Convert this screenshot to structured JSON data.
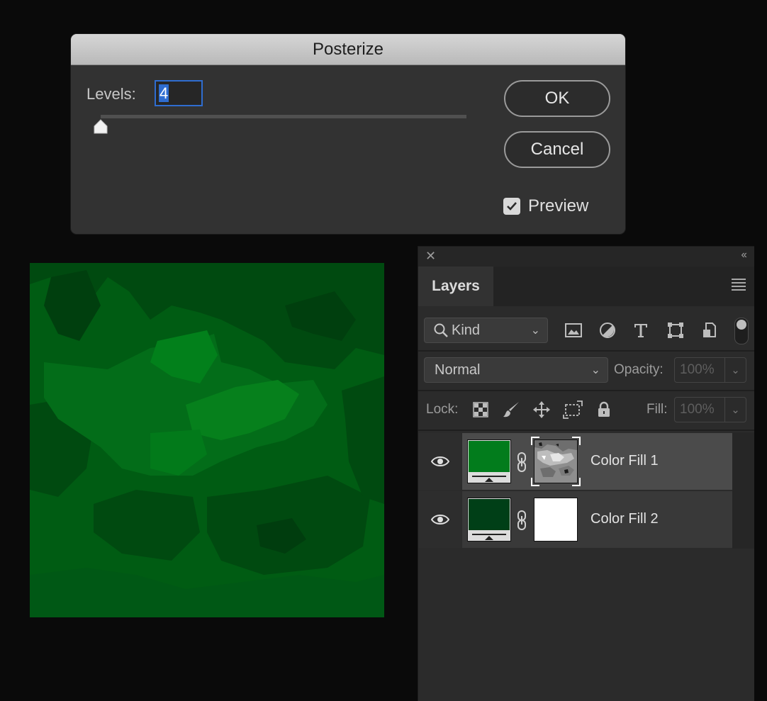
{
  "dialog": {
    "title": "Posterize",
    "levels_label": "Levels:",
    "levels_value": "4",
    "ok_label": "OK",
    "cancel_label": "Cancel",
    "preview_label": "Preview",
    "preview_checked": true
  },
  "canvas": {
    "colors": [
      "#005c13",
      "#004a10",
      "#027a1a",
      "#00661a",
      "#004d12"
    ]
  },
  "layers_panel": {
    "tab_label": "Layers",
    "filter": {
      "kind_label": "Kind",
      "icons": [
        "image-filter-icon",
        "adjustment-filter-icon",
        "type-filter-icon",
        "shape-filter-icon",
        "smart-object-filter-icon"
      ]
    },
    "blend_mode": "Normal",
    "opacity_label": "Opacity:",
    "opacity_value": "100%",
    "lock_label": "Lock:",
    "fill_label": "Fill:",
    "fill_value": "100%",
    "layers": [
      {
        "name": "Color Fill 1",
        "fill_color": "#027c1c",
        "selected": true
      },
      {
        "name": "Color Fill 2",
        "fill_color": "#003f17",
        "selected": false
      }
    ]
  }
}
